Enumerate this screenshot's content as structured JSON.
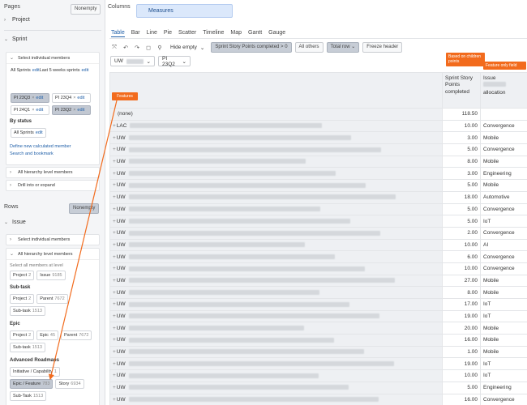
{
  "left": {
    "pages_title": "Pages",
    "nonempty_label": "Nonempty",
    "project_label": "Project",
    "sprint": {
      "label": "Sprint",
      "select_label": "Select individual members",
      "items": [
        {
          "name": "All Sprints",
          "action": "edit"
        },
        {
          "name": "Last 5 weeks sprints",
          "action": "edit"
        }
      ],
      "pi_chips": [
        {
          "name": "PI 23Q3",
          "action": "edit",
          "selected": true
        },
        {
          "name": "PI 23Q4",
          "action": "edit",
          "selected": false
        },
        {
          "name": "PI 24Q1",
          "action": "edit",
          "selected": false
        },
        {
          "name": "PI 23Q2",
          "action": "edit",
          "selected": true
        }
      ],
      "by_status_label": "By status",
      "all_sprints_status": "All Sprints",
      "edit_label": "edit",
      "define_link": "Define new calculated member",
      "search_link": "Search and bookmark",
      "all_hierarchy_label": "All hierarchy level members",
      "drill_label": "Drill into or expand"
    },
    "rows_title": "Rows",
    "rows_nonempty": "Nonempty",
    "issue": {
      "label": "Issue",
      "select_label": "Select individual members",
      "all_hierarchy_label": "All hierarchy level members",
      "select_all_label": "Select all members at level",
      "level_chips": [
        {
          "name": "Project",
          "count": "2"
        },
        {
          "name": "Issue",
          "count": "9185"
        }
      ],
      "subtask": {
        "label": "Sub-task",
        "chips": [
          {
            "name": "Project",
            "count": "2"
          },
          {
            "name": "Parent",
            "count": "7672"
          },
          {
            "name": "Sub-task",
            "count": "1513"
          }
        ]
      },
      "epic": {
        "label": "Epic",
        "chips": [
          {
            "name": "Project",
            "count": "2"
          },
          {
            "name": "Epic",
            "count": "45"
          },
          {
            "name": "Parent",
            "count": "7672"
          },
          {
            "name": "Sub-task",
            "count": "1513"
          }
        ]
      },
      "advanced": {
        "label": "Advanced Roadmaps",
        "chips": [
          {
            "name": "Initiative / Capability",
            "count": "1"
          },
          {
            "name": "Epic / Feature",
            "count": "783",
            "selected": true
          },
          {
            "name": "Story",
            "count": "6934"
          },
          {
            "name": "Sub-Task",
            "count": "1513"
          }
        ]
      }
    }
  },
  "right": {
    "columns_label": "Columns",
    "measures_label": "Measures",
    "tabs": [
      "Table",
      "Bar",
      "Line",
      "Pie",
      "Scatter",
      "Timeline",
      "Map",
      "Gantt",
      "Gauge"
    ],
    "active_tab": "Table",
    "toolbar": {
      "hide_empty": "Hide empty",
      "filter_chip": "Sprint Story Points completed > 0",
      "all_others": "All others",
      "total_row": "Total row",
      "freeze_header": "Freeze header"
    },
    "page_selectors": [
      {
        "value": "UW",
        "blurred": true
      },
      {
        "value": "PI 23Q2",
        "blurred": false
      }
    ],
    "annotations": {
      "features": "Features",
      "children_points": "Based on children points",
      "feature_only": "Feature only field"
    },
    "table": {
      "col_sprint": "Sprint Story Points completed",
      "col_issue": "Issue",
      "col_issue_sub": "allocation",
      "none_label": "(none)",
      "rows": [
        {
          "label": "(none)",
          "points": "118.50",
          "alloc": ""
        },
        {
          "label": "LAC",
          "points": "10.00",
          "alloc": "Convergence"
        },
        {
          "label": "UW",
          "points": "3.00",
          "alloc": "Mobile"
        },
        {
          "label": "UW",
          "points": "5.00",
          "alloc": "Convergence"
        },
        {
          "label": "UW",
          "points": "8.00",
          "alloc": "Mobile"
        },
        {
          "label": "UW",
          "points": "3.00",
          "alloc": "Engineering"
        },
        {
          "label": "UW",
          "points": "5.00",
          "alloc": "Mobile"
        },
        {
          "label": "UW",
          "points": "18.00",
          "alloc": "Automotive"
        },
        {
          "label": "UW",
          "points": "5.00",
          "alloc": "Convergence"
        },
        {
          "label": "UW",
          "points": "5.00",
          "alloc": "IoT"
        },
        {
          "label": "UW",
          "points": "2.00",
          "alloc": "Convergence"
        },
        {
          "label": "UW",
          "points": "10.00",
          "alloc": "AI"
        },
        {
          "label": "UW",
          "points": "6.00",
          "alloc": "Convergence"
        },
        {
          "label": "UW",
          "points": "10.00",
          "alloc": "Convergence"
        },
        {
          "label": "UW",
          "points": "27.00",
          "alloc": "Mobile"
        },
        {
          "label": "UW",
          "points": "8.00",
          "alloc": "Mobile"
        },
        {
          "label": "UW",
          "points": "17.00",
          "alloc": "IoT"
        },
        {
          "label": "UW",
          "points": "19.00",
          "alloc": "IoT"
        },
        {
          "label": "UW",
          "points": "20.00",
          "alloc": "Mobile"
        },
        {
          "label": "UW",
          "points": "16.00",
          "alloc": "Mobile"
        },
        {
          "label": "UW",
          "points": "1.00",
          "alloc": "Mobile"
        },
        {
          "label": "UW",
          "points": "19.00",
          "alloc": "IoT"
        },
        {
          "label": "UW",
          "points": "10.00",
          "alloc": "IoT"
        },
        {
          "label": "UW",
          "points": "5.00",
          "alloc": "Engineering"
        },
        {
          "label": "UW",
          "points": "16.00",
          "alloc": "Convergence"
        }
      ]
    }
  },
  "colors": {
    "accent": "#1f5fa8",
    "annotation": "#f26b1d",
    "measures_bg": "#dbe8fb"
  }
}
